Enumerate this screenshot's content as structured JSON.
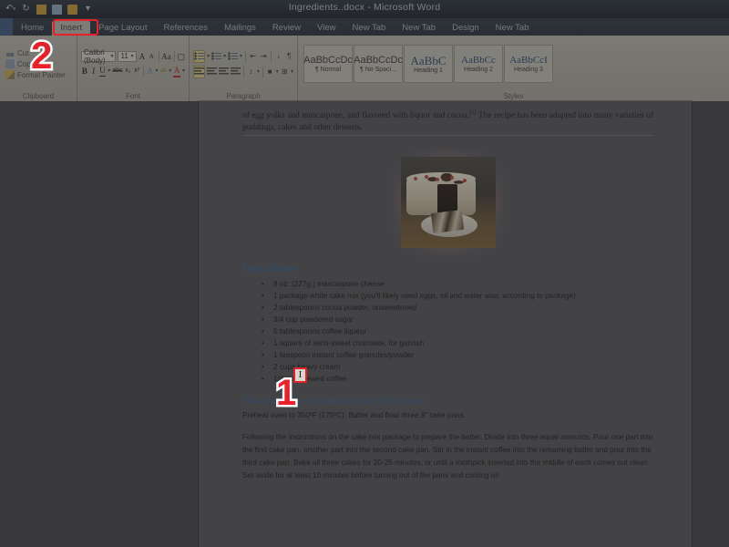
{
  "window": {
    "title": "Ingredients..docx - Microsoft Word",
    "quick_access": [
      {
        "name": "undo-icon",
        "glyph": "↶"
      },
      {
        "name": "redo-icon",
        "glyph": "↻"
      },
      {
        "name": "open-icon",
        "glyph": ""
      },
      {
        "name": "save-icon",
        "glyph": ""
      },
      {
        "name": "new-icon",
        "glyph": ""
      },
      {
        "name": "customize-quick-access-icon",
        "glyph": "▾"
      }
    ]
  },
  "tabs": [
    {
      "label": "Home",
      "active": false
    },
    {
      "label": "Insert",
      "active": true
    },
    {
      "label": "Page Layout",
      "active": false
    },
    {
      "label": "References",
      "active": false
    },
    {
      "label": "Mailings",
      "active": false
    },
    {
      "label": "Review",
      "active": false
    },
    {
      "label": "View",
      "active": false
    },
    {
      "label": "New Tab",
      "active": false
    },
    {
      "label": "New Tab",
      "active": false
    },
    {
      "label": "Design",
      "active": false
    },
    {
      "label": "New Tab",
      "active": false
    }
  ],
  "ribbon": {
    "clipboard": {
      "group_label": "Clipboard",
      "items": [
        {
          "label": "Cut",
          "icon": "scissors-icon"
        },
        {
          "label": "Copy",
          "icon": "copy-icon"
        },
        {
          "label": "Format Painter",
          "icon": "format-painter-icon"
        }
      ]
    },
    "font": {
      "group_label": "Font",
      "font_name": "Calibri (Body)",
      "font_size": "11",
      "buttons": [
        {
          "label": "A",
          "name": "grow-font-button"
        },
        {
          "label": "A",
          "name": "shrink-font-button"
        },
        {
          "label": "Aa",
          "name": "change-case-button"
        },
        {
          "label": "B",
          "name": "bold-button"
        },
        {
          "label": "I",
          "name": "italic-button"
        },
        {
          "label": "U",
          "name": "underline-button"
        },
        {
          "label": "abc",
          "name": "strikethrough-button"
        },
        {
          "label": "x₂",
          "name": "subscript-button"
        },
        {
          "label": "x²",
          "name": "superscript-button"
        },
        {
          "label": "A",
          "name": "text-effects-button"
        },
        {
          "label": "ab",
          "name": "text-highlight-button"
        },
        {
          "label": "A",
          "name": "font-color-button"
        }
      ]
    },
    "paragraph": {
      "group_label": "Paragraph",
      "buttons": [
        {
          "name": "bullets-button"
        },
        {
          "name": "numbering-button"
        },
        {
          "name": "multilevel-list-button"
        },
        {
          "name": "decrease-indent-button",
          "glyph": "⇤"
        },
        {
          "name": "increase-indent-button",
          "glyph": "⇥"
        },
        {
          "name": "sort-button",
          "glyph": "↓"
        },
        {
          "name": "show-formatting-marks-button",
          "glyph": "¶"
        },
        {
          "name": "align-left-button"
        },
        {
          "name": "align-center-button"
        },
        {
          "name": "align-right-button"
        },
        {
          "name": "justify-button"
        },
        {
          "name": "line-spacing-button",
          "glyph": "↕"
        },
        {
          "name": "shading-button",
          "glyph": "■"
        },
        {
          "name": "borders-button",
          "glyph": "⊞"
        }
      ]
    },
    "styles": {
      "group_label": "Styles",
      "items": [
        {
          "preview": "AaBbCcDc",
          "label": "¶ Normal",
          "heading": false
        },
        {
          "preview": "AaBbCcDc",
          "label": "¶ No Spaci...",
          "heading": false
        },
        {
          "preview": "AaBbC",
          "label": "Heading 1",
          "heading": true
        },
        {
          "preview": "AaBbCc",
          "label": "Heading 2",
          "heading": true
        },
        {
          "preview": "AaBbCcI",
          "label": "Heading 3",
          "heading": true
        }
      ]
    }
  },
  "document": {
    "intro_line1": "of egg yolks and mascarpone,  and flavored with liquor and cocoa.",
    "intro_ref": "[1]",
    "intro_line1b": " The  recipe  has  been",
    "intro_line2": "adapted  into many  varieties  of puddings,  cakes and other  desserts.",
    "figure_alt": "tiramisu-cake-photo",
    "ingredients_heading": "Ingredients",
    "ingredients": [
      "8 oz. (227g.) mascarpone cheese",
      "1 package white  cake mix (you’ll likely need eggs, oil and water also,  according to package)",
      "2 tablespoons cocoa powder, unsweetened",
      "3/4 cup powdered sugar",
      "5 tablespoons coffee liqueur",
      "1 square of semi-sweet chocolate, for garnish",
      "1 teaspoon instant coffee granules/powder",
      "2 cups heavy cream",
      "1/4 cup brewed coffee"
    ],
    "directions_heading": "How to make Tiramisu Cake directions",
    "directions_line1": "Preheat oven to 350ºF (175ºC). Butter and flour three 9” cake pans.",
    "directions_body": "Following the instructions on the cake mix package to prepare the batter. Divide into three equal amounts. Pour one part into the first cake pan, another part into the second cake pan. Stir in the instant coffee into the remaining batter and pour into the third cake pan. Bake all three cakes for 20-25 minutes, or until a toothpick inserted into the middle of each comes out clean. Set aside for at least 10 minutes before turning out of the pans and cooling on"
  },
  "annotations": {
    "step_one": "1",
    "step_two": "2",
    "caret_glyph": "I",
    "marker_color": "#e8202a",
    "marker_outline": "#ffffff"
  }
}
